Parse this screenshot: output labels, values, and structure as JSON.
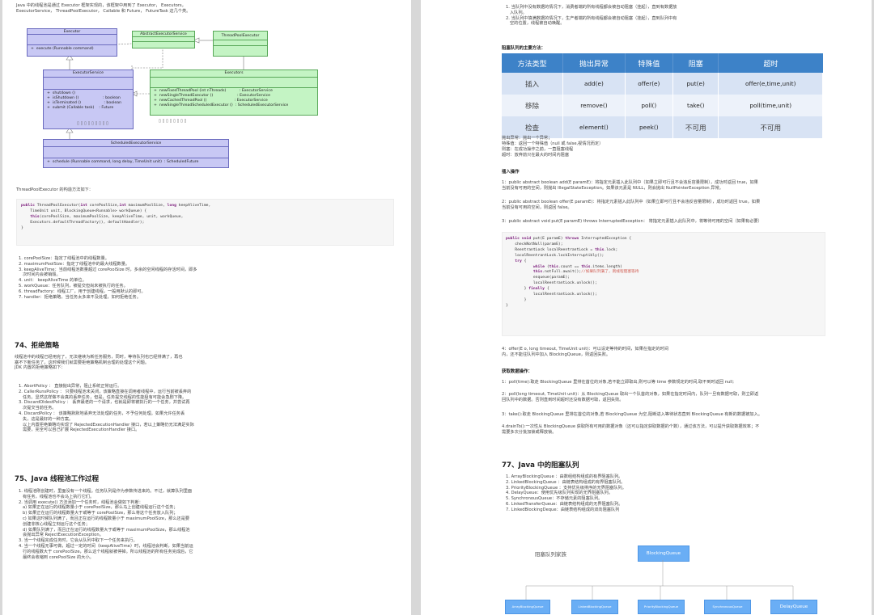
{
  "left_page": {
    "intro": "Java 中的线程池是通过 Executor 框架实现的，该框架中用到了 Executor， Executors，\nExecutorService， ThreadPoolExecutor， Callable 和 Future， FutureTask 这几个类。",
    "uml": {
      "executor": {
        "name": "Executor",
        "method": "+  execute (Runnable command)"
      },
      "abstract_service": {
        "name": "AbstractExecutorService"
      },
      "tpe": {
        "name": "ThreadPoolExecutor"
      },
      "executor_service": {
        "name": "ExecutorService",
        "methods": [
          "+  shutdown ()",
          "+  isShutdown ()                    : boolean",
          "+  isTerminated ()                   : boolean",
          "+  submit (Callable task)    : Future"
        ]
      },
      "executors": {
        "name": "Executors",
        "methods": [
          "+  newFixedThreadPool (int nThreads)           : ExecutorService",
          "+  newSingleThreadExecutor ()                    : ExecutorService",
          "+  newCachedThreadPool ()                       : ExecutorService",
          "+  newSingleThreadScheduledExecutor ()  : ScheduledExecutorService"
        ]
      },
      "garble_1": "▯ ▯ ▯ ▯ ▯ ▯ ▯ ▯ ▯",
      "garble_2": "▯ ▯ ▯ ▯ ▯ ▯ ▯ ▯",
      "scheduled": {
        "name": "ScheduledExecutorService",
        "method": "+  schedule (Runnable command, long delay, TimeUnit unit)  : ScheduledFuture"
      }
    },
    "ctor_label": "ThreadPoolExecutor 的构造方法如下：",
    "ctor_code": [
      "public ThreadPoolExecutor(int corePoolSize,int maximumPoolSize, long keepAliveTime,",
      "    TimeUnit unit, BlockingQueue<Runnable> workQueue) {",
      "",
      "    this(corePoolSize, maximumPoolSize, keepAliveTime, unit, workQueue,",
      "    Executors.defaultThreadFactory(), defaultHandler);",
      "}"
    ],
    "params": [
      "1. corePoolSize：指定了线程池中的线程数量。",
      "2. maximumPoolSize：指定了线程池中的最大线程数量。",
      "3. keepAliveTime：当前线程池数量超过 corePoolSize 时，多余的空闲线程的存活时间，即多\n   次时间内会被销毁。",
      "4. unit： keepAliveTime 的单位。",
      "5. workQueue：任务队列，被提交但尚未被执行的任务。",
      "6. threadFactory：线程工厂，用于创建线程，一般用默认的即可。",
      "7. handler：拒绝策略，当任务太多来不及处理，如何拒绝任务。"
    ],
    "sec74_title": "74、拒绝策略",
    "sec74_intro": "线程池中的线程已经用完了，无法继续为新任务服务，同时，等待队列也已经排满了，再也\n塞不下新任务了。这时候我们就需要拒绝策略机制合理的处理这个问题。\nJDK 内置的拒绝策略如下：",
    "policies": [
      "1. AbortPolicy ： 直接抛出异常，阻止系统正常运行。",
      "2. CallerRunsPolicy ： 只要线程池未关闭，该策略直接在调用者线程中，运行当前被丢弃的\n   任务。显然这样做不会真的丢弃任务，但是，任务提交线程的性能极有可能会急剧下降。",
      "3. DiscardOldestPolicy ： 丢弃最老的一个请求，也就是即将被执行的一个任务，并尝试再\n   次提交当前任务。",
      "4. DiscardPolicy ： 该策略默默地丢弃无法处理的任务，不予任何处理。如果允许任务丢\n   失，这是最好的一种方案。\n   以上内置拒绝策略均实现了 RejectedExecutionHandler 接口，若以上策略仍无法满足实际\n   需要，完全可以自己扩展 RejectedExecutionHandler 接口。"
    ],
    "sec75_title": "75、Java 线程池工作过程",
    "process": [
      "1. 线程池刚创建时，里面没有一个线程。任务队列是作为参数传进来的。不过，就算队列里面\n   有任务，线程池也不会马上执行它们。",
      "2. 当调用 execute() 方法添加一个任务时，线程池会做如下判断：\n   a) 如果正在运行的线程数量小于 corePoolSize，那么马上创建线程运行这个任务；\n   b) 如果正在运行的线程数量大于或等于 corePoolSize，那么将这个任务放入队列；\n   c) 如果这时候队列满了，而且正在运行的线程数量小于 maximumPoolSize，那么还是要\n   创建非核心线程立刻运行这个任务；\n   d) 如果队列满了，而且正在运行的线程数量大于或等于 maximumPoolSize，那么线程池\n   会抛出异常 RejectExecutionException。",
      "3. 当一个线程完成任务时，它会从队列中取下一个任务来执行。",
      "4. 当一个线程无事可做，超过一定的时间（keepAliveTime）时，线程池会判断，如果当前运\n   行的线程数大于 corePoolSize，那么这个线程就被停掉。所以线程池的所有任务完成后，它\n   最终会收缩到 corePoolSize 的大小。"
    ]
  },
  "right_page": {
    "top_items": [
      "1. 当队列中没有数据的情况下，消费者端的所有线程都会被自动阻塞（挂起），直到有数据放\n   入队列。",
      "2. 当队列中填满数据的情况下，生产者端的所有线程都会被自动阻塞（挂起），直到队列中有\n   空的位置，线程被自动唤醒。"
    ],
    "methods_heading": "阻塞队列的主要方法：",
    "table": {
      "headers": [
        "方法类型",
        "抛出异常",
        "特殊值",
        "阻塞",
        "超时"
      ],
      "rows": [
        [
          "插入",
          "add(e)",
          "offer(e)",
          "put(e)",
          "offer(e,time,unit)"
        ],
        [
          "移除",
          "remove()",
          "poll()",
          "take()",
          "poll(time,unit)"
        ],
        [
          "检查",
          "element()",
          "peek()",
          "不可用",
          "不可用"
        ]
      ]
    },
    "legend": [
      "抛出异常：抛出一个异常；",
      "特殊值：返回一个特殊值（null 或 false,视情况而定）",
      "则塞：在成功操作之前，一直阻塞线程",
      "超时：放弃前只在最大的时间内阻塞"
    ],
    "insert_heading": "插入操作",
    "insert_items": [
      "1：public abstract boolean add(E paramE)：将指定元素插入此队列中（如果立即可行且不会违反容量限制），成功时返回 true，如果\n当前没有可用的空间，则抛出 IllegalStateException。如果该元素是 NULL，则会抛出 NullPointerException 异常。",
      "2：public abstract boolean offer(E paramE)：将指定元素插入此队列中（如果立即可行且不会违反容量限制），成功时返回 true，如果\n当前没有可用的空间，则返回 false。",
      "3：public abstract void put(E paramE) throws InterruptedException： 将指定元素插入此队列中，将等待可用的空间（如果有必要）"
    ],
    "put_code": [
      "public void put(E paramE) throws InterruptedException {",
      "    checkNotNull(paramE);",
      "    ReentrantLock localReentrantLock = this.lock;",
      "    localReentrantLock.lockInterruptibly();",
      "    try {",
      "            while (this.count == this.items.length)",
      "            this.notFull.await();//如果队列满了，则线程阻塞等待",
      "            enqueue(paramE);",
      "            localReentrantLock.unlock();",
      "        } finally {",
      "            localReentrantLock.unlock();",
      "        }",
      "}"
    ],
    "offer_timeout": "4：offer(E o, long timeout, TimeUnit unit)：可以设定等待的时间，如果在指定的时间\n内，还不能往队列中加入 BlockingQueue，则返回失败。",
    "get_heading": "获取数据操作：",
    "get_items": [
      "1：poll(time):取走 BlockingQueue 里排在首位的对象,若不能立即取出,则可以等 time 参数规定的时间,取不到时返回 null;",
      "2：poll(long timeout, TimeUnit unit)：从 BlockingQueue 取出一个队首的对象，如果在指定时间内，队列一旦有数据可取，则立即返\n回队列中的数据。否则直到时间超时还没有数据可取，返回失败。",
      "3：take():取走 BlockingQueue 里排在首位的对象,若 BlockingQueue 为空,阻断进入等待状态直到 BlockingQueue 有新的数据被加入。",
      "4.drainTo():一次性从 BlockingQueue 获取所有可用的数据对象（还可以指定获取数据的个数），通过该方法，可以提升获取数据效率；不\n需要多次分批加锁或释放锁。"
    ],
    "sec77_title": "77、Java 中的阻塞队列",
    "queues": [
      "1. ArrayBlockingQueue ：由数组结构组成的有界阻塞队列。",
      "2. LinkedBlockingQueue ：由链表结构组成的有界阻塞队列。",
      "3. PriorityBlockingQueue ：支持优先级排序的无界阻塞队列。",
      "4. DelayQueue：使用优先级队列实现的无界阻塞队列。",
      "5. SynchronousQueue：不存储元素的阻塞队列。",
      "6. LinkedTransferQueue：由链表结构组成的无界阻塞队列。",
      "7. LinkedBlockingDeque：由链表结构组成的双向阻塞队列"
    ],
    "family": {
      "title": "阻塞队列家族",
      "root": "BlockingQueue",
      "children": [
        "ArrayBlockingQueue",
        "LinkedBlockingQueue",
        "PriorityBlockingQueue",
        "SynchronousQueue",
        "DelayQueue"
      ]
    }
  }
}
